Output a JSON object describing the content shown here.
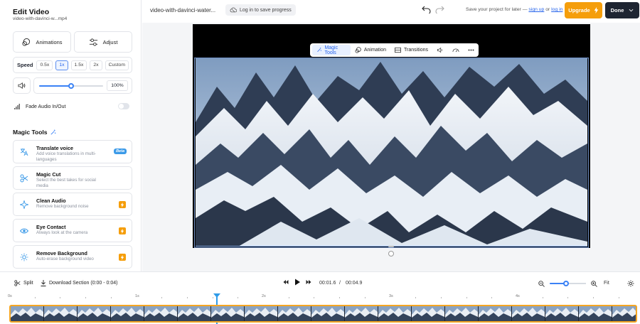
{
  "sidebar": {
    "title": "Edit Video",
    "filename": "video-with-davinci-w...mp4",
    "animations_label": "Animations",
    "adjust_label": "Adjust",
    "speed_label": "Speed",
    "speed_options": [
      "0.5x",
      "1x",
      "1.5x",
      "2x",
      "Custom"
    ],
    "speed_selected": "1x",
    "volume_value": "100%",
    "volume_level": 0.5,
    "fade_label": "Fade Audio In/Out",
    "magic_tools_heading": "Magic Tools",
    "tools": [
      {
        "name": "Translate voice",
        "desc": "Add voice translations in multi-languages",
        "badge": "Beta"
      },
      {
        "name": "Magic Cut",
        "desc": "Select the best takes for social media"
      },
      {
        "name": "Clean Audio",
        "desc": "Remove background noise"
      },
      {
        "name": "Eye Contact",
        "desc": "Always look at the camera"
      },
      {
        "name": "Remove Background",
        "desc": "Auto-erase background video"
      }
    ]
  },
  "topbar": {
    "project_name": "video-with-davinci-water...",
    "save_progress": "Log in to save progress",
    "save_later_prefix": "Save your project for later —",
    "sign_up": "sign up",
    "or": "or",
    "log_in": "log in",
    "upgrade": "Upgrade",
    "done": "Done"
  },
  "floatbar": {
    "magic_tools": "Magic Tools",
    "animation": "Animation",
    "transitions": "Transitions"
  },
  "controls": {
    "split": "Split",
    "download_section": "Download Section (0:00 - 0:04)",
    "current_time": "00:01.6",
    "separator": "/",
    "total_time": "00:04.9",
    "fit": "Fit",
    "zoom_level": 0.45
  },
  "ruler": {
    "labels": [
      "0s",
      "1s",
      "2s",
      "3s",
      "4s"
    ]
  },
  "colors": {
    "accent": "#3b82f6",
    "upgrade": "#f59e0b",
    "done": "#1e2532",
    "track_border": "#f5a623"
  }
}
